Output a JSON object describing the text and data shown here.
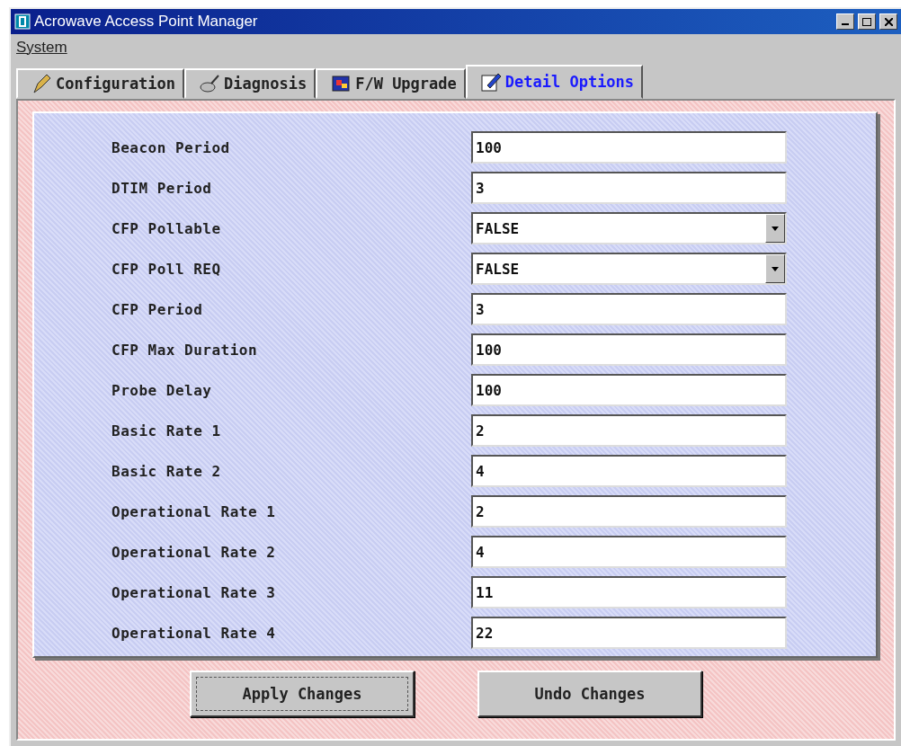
{
  "window": {
    "title": "Acrowave Access Point Manager"
  },
  "menu": [
    {
      "label": "System"
    }
  ],
  "tabs": [
    {
      "label": "Configuration",
      "selected": false
    },
    {
      "label": "Diagnosis",
      "selected": false
    },
    {
      "label": "F/W Upgrade",
      "selected": false
    },
    {
      "label": "Detail Options",
      "selected": true
    }
  ],
  "fields": [
    {
      "label": "Beacon Period",
      "kind": "text",
      "value": "100"
    },
    {
      "label": "DTIM Period",
      "kind": "text",
      "value": "3"
    },
    {
      "label": "CFP Pollable",
      "kind": "select",
      "value": "FALSE"
    },
    {
      "label": "CFP Poll REQ",
      "kind": "select",
      "value": "FALSE"
    },
    {
      "label": "CFP Period",
      "kind": "text",
      "value": "3"
    },
    {
      "label": "CFP Max Duration",
      "kind": "text",
      "value": "100"
    },
    {
      "label": "Probe Delay",
      "kind": "text",
      "value": "100"
    },
    {
      "label": "Basic Rate 1",
      "kind": "text",
      "value": "2"
    },
    {
      "label": "Basic Rate 2",
      "kind": "text",
      "value": "4"
    },
    {
      "label": "Operational Rate 1",
      "kind": "text",
      "value": "2"
    },
    {
      "label": "Operational Rate 2",
      "kind": "text",
      "value": "4"
    },
    {
      "label": "Operational Rate 3",
      "kind": "text",
      "value": "11"
    },
    {
      "label": "Operational Rate 4",
      "kind": "text",
      "value": "22"
    }
  ],
  "buttons": [
    {
      "label": "Apply Changes",
      "focused": true
    },
    {
      "label": "Undo Changes",
      "focused": false
    }
  ]
}
